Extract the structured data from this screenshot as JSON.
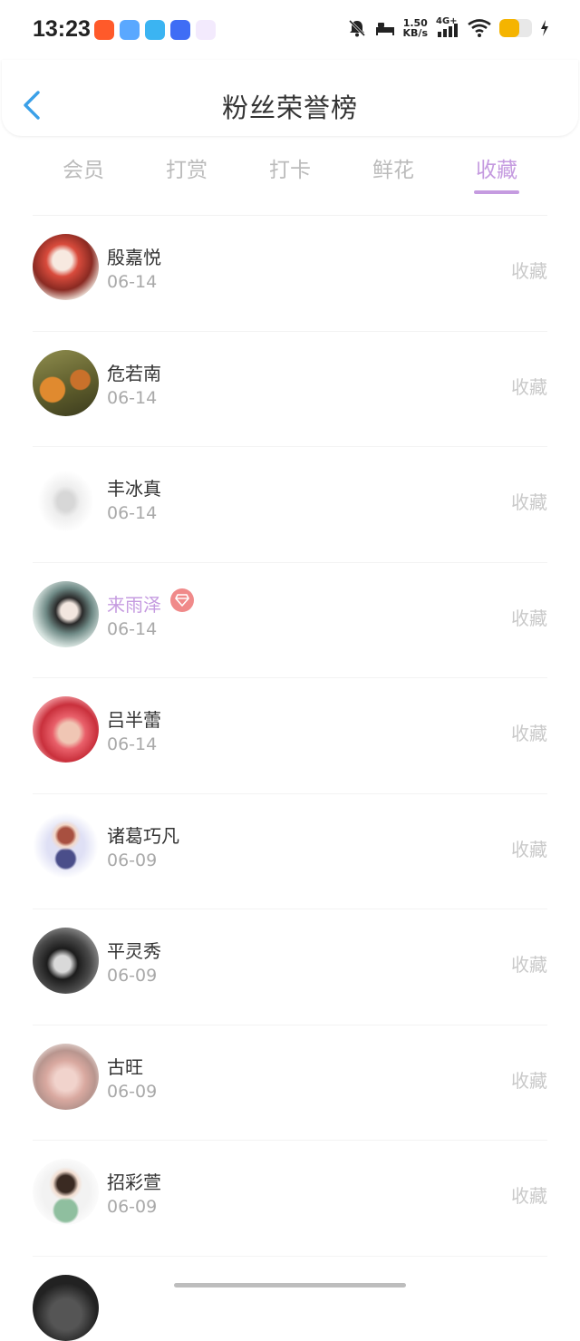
{
  "status_bar": {
    "time": "13:23",
    "speed_value": "1.50",
    "speed_unit": "KB/s",
    "network": "4G+",
    "battery_percent": 0.6,
    "icons": [
      "bell-off-icon",
      "bed-icon",
      "signal-icon",
      "wifi-icon",
      "battery-icon",
      "charging-icon"
    ]
  },
  "header": {
    "title": "粉丝荣誉榜",
    "back_icon": "chevron-left-icon"
  },
  "tabs": [
    {
      "label": "会员",
      "active": false
    },
    {
      "label": "打赏",
      "active": false
    },
    {
      "label": "打卡",
      "active": false
    },
    {
      "label": "鲜花",
      "active": false
    },
    {
      "label": "收藏",
      "active": true
    }
  ],
  "colors": {
    "accent": "#c59be0",
    "back_arrow": "#3aa0e8",
    "vip_badge": "#f08a8a"
  },
  "fans": [
    {
      "name": "殷嘉悦",
      "date": "06-14",
      "action": "收藏",
      "vip": false
    },
    {
      "name": "危若南",
      "date": "06-14",
      "action": "收藏",
      "vip": false
    },
    {
      "name": "丰冰真",
      "date": "06-14",
      "action": "收藏",
      "vip": false
    },
    {
      "name": "来雨泽",
      "date": "06-14",
      "action": "收藏",
      "vip": true
    },
    {
      "name": "吕半蕾",
      "date": "06-14",
      "action": "收藏",
      "vip": false
    },
    {
      "name": "诸葛巧凡",
      "date": "06-09",
      "action": "收藏",
      "vip": false
    },
    {
      "name": "平灵秀",
      "date": "06-09",
      "action": "收藏",
      "vip": false
    },
    {
      "name": "古旺",
      "date": "06-09",
      "action": "收藏",
      "vip": false
    },
    {
      "name": "招彩萱",
      "date": "06-09",
      "action": "收藏",
      "vip": false
    }
  ]
}
